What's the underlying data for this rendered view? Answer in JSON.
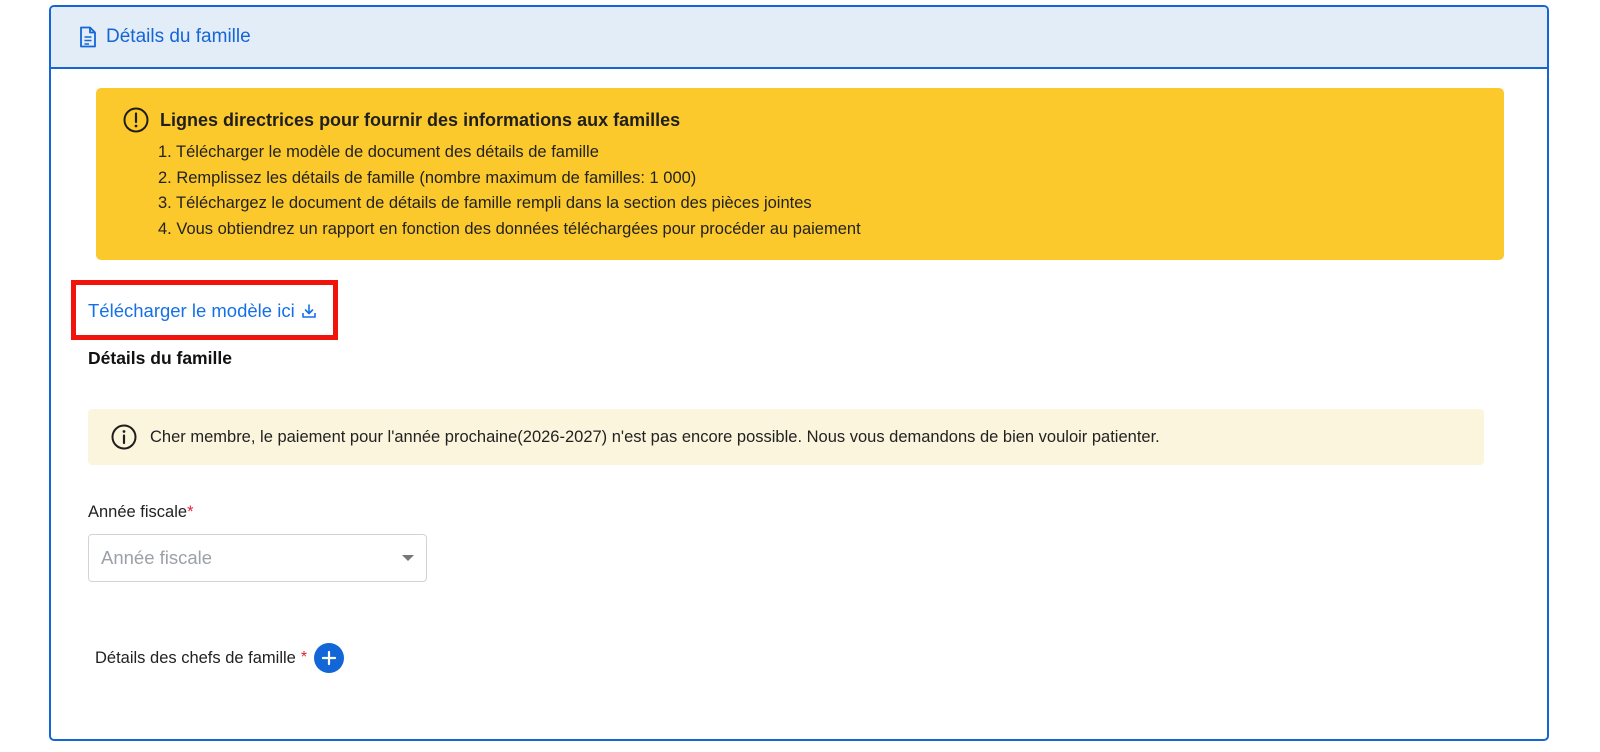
{
  "header": {
    "title": "Détails du famille",
    "icon": "document-icon"
  },
  "guidelines": {
    "title": "Lignes directrices pour fournir des informations aux familles",
    "icon": "exclamation-circle-icon",
    "items": [
      "1. Télécharger le modèle de document des détails de famille",
      "2. Remplissez les détails de famille (nombre maximum de familles: 1 000)",
      "3. Téléchargez le document de détails de famille rempli dans la section des pièces jointes",
      "4. Vous obtiendrez un rapport en fonction des données téléchargées pour procéder au paiement"
    ],
    "bg_color": "#fcc92c"
  },
  "download": {
    "label": "Télécharger le modèle ici",
    "icon": "download-icon",
    "highlight_color": "#f0140c"
  },
  "section_title": "Détails du famille",
  "notice": {
    "icon": "info-circle-icon",
    "text": "Cher membre, le paiement pour l'année prochaine(2026-2027) n'est pas encore possible. Nous vous demandons de bien vouloir patienter."
  },
  "fiscal_year": {
    "label": "Année fiscale",
    "required_mark": "*",
    "placeholder": "Année fiscale"
  },
  "family_heads": {
    "label": "Détails des chefs de famille",
    "required_mark": "*",
    "add_icon": "plus-icon"
  },
  "colors": {
    "primary": "#1565d8",
    "header_bg": "#e2edf8",
    "notice_bg": "#fcf5dd",
    "required": "#e0203a"
  }
}
